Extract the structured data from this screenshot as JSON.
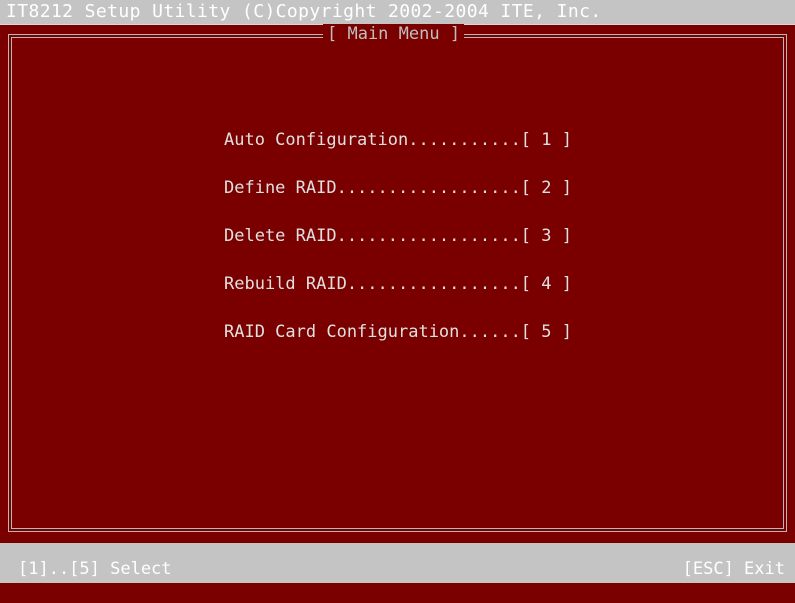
{
  "window": {
    "title": "IT8212 Setup Utility (C)Copyright 2002-2004 ITE, Inc."
  },
  "frame": {
    "title": "[ Main Menu ]"
  },
  "menu": {
    "items": [
      {
        "label": "Auto Configuration...........[ 1 ]"
      },
      {
        "label": "Define RAID..................[ 2 ]"
      },
      {
        "label": "Delete RAID..................[ 3 ]"
      },
      {
        "label": "Rebuild RAID.................[ 4 ]"
      },
      {
        "label": "RAID Card Configuration......[ 5 ]"
      }
    ]
  },
  "status": {
    "left": "[1]..[5] Select",
    "right": "[ESC] Exit"
  },
  "colors": {
    "background": "#7a0000",
    "bar": "#c4c4c4",
    "text": "#e0e0e0"
  }
}
